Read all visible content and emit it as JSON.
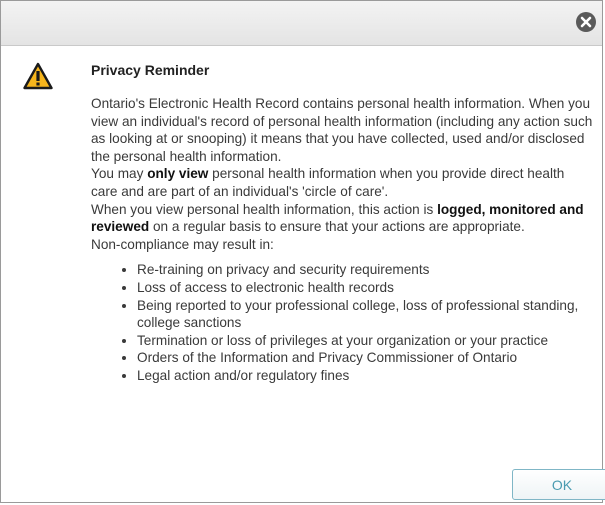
{
  "dialog": {
    "title": "Privacy Reminder",
    "close_icon": "close-circle-icon",
    "warning_icon": "warning-triangle-icon",
    "paragraph1": "Ontario's Electronic Health Record contains personal health information. When you view an individual's record of personal health information (including any action such as looking at or snooping) it means that you have collected, used and/or disclosed the personal health information.",
    "paragraph2": {
      "before": "You may ",
      "bold": "only view",
      "after": " personal health information when you provide direct health care and are part of an individual's 'circle of care'."
    },
    "paragraph3": {
      "before": "When you view personal health information, this action is ",
      "bold": "logged, monitored and reviewed",
      "after": " on a regular basis to ensure that your actions are appropriate."
    },
    "paragraph4": "Non-compliance may result in:",
    "consequences": [
      "Re-training on privacy and security requirements",
      "Loss of access to electronic health records",
      "Being reported to your professional college, loss of professional standing, college sanctions",
      "Termination or loss of privileges at your organization or your practice",
      "Orders of the Information and Privacy Commissioner of Ontario",
      "Legal action and/or regulatory fines"
    ],
    "ok_label": "OK"
  },
  "colors": {
    "warning_fill": "#f6b51c",
    "ok_text": "#4a9bb0",
    "ok_border": "#7fb6c6"
  }
}
